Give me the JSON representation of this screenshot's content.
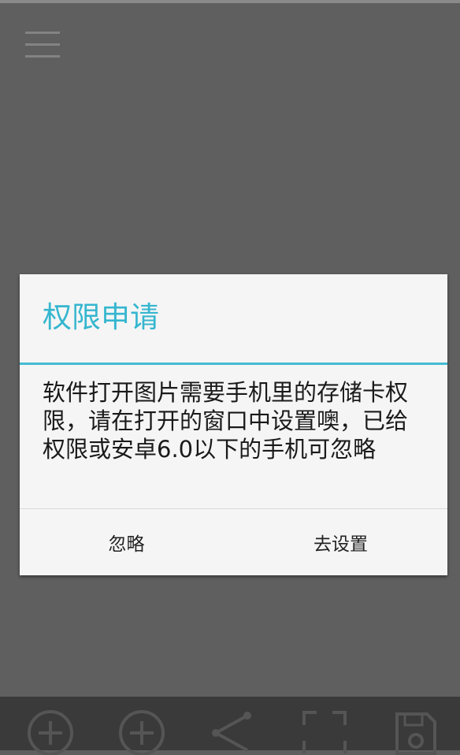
{
  "header": {
    "menu_icon": "hamburger-menu-icon"
  },
  "dialog": {
    "title": "权限申请",
    "message": "软件打开图片需要手机里的存储卡权限，请在打开的窗口中设置噢，已给权限或安卓6.0以下的手机可忽略",
    "buttons": {
      "ignore": "忽略",
      "settings": "去设置"
    }
  },
  "toolbar": {
    "icons": [
      "zoom-in-icon",
      "add-icon",
      "share-icon",
      "crop-icon",
      "save-icon"
    ]
  },
  "colors": {
    "background": "#5f5f5f",
    "dialog_background": "#f5f5f5",
    "accent": "#35b6cf",
    "toolbar": "#3a3a3a"
  }
}
